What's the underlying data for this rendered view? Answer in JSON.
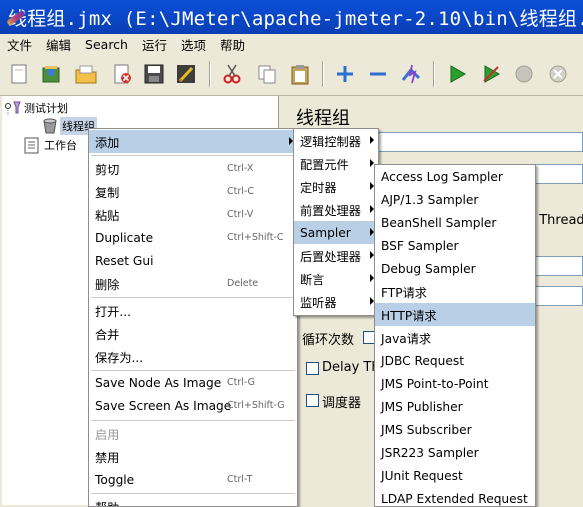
{
  "window": {
    "title": "线程组.jmx (E:\\JMeter\\apache-jmeter-2.10\\bin\\线程组."
  },
  "menubar": [
    "文件",
    "编辑",
    "Search",
    "运行",
    "选项",
    "帮助"
  ],
  "toolbar_icons": [
    "new-icon",
    "templates-icon",
    "open-icon",
    "close-icon",
    "save-icon",
    "save-as-image-icon",
    "cut-icon",
    "copy-icon",
    "paste-icon",
    "expand-icon",
    "collapse-icon",
    "toggle-icon",
    "start-icon",
    "start-no-pauses-icon",
    "stop-icon",
    "shutdown-icon"
  ],
  "tree": {
    "root": "测试计划",
    "thread_group": "线程组",
    "workbench": "工作台"
  },
  "panel": {
    "title": "线程组",
    "truncated_thread": "t Thread",
    "loop_label": "循环次数",
    "delay_label": "Delay Thr",
    "scheduler_label": "调度器"
  },
  "context_menu": {
    "items": [
      {
        "label": "添加",
        "submenu": true,
        "highlighted": true
      },
      {
        "label": "剪切",
        "shortcut": "Ctrl-X"
      },
      {
        "label": "复制",
        "shortcut": "Ctrl-C"
      },
      {
        "label": "粘贴",
        "shortcut": "Ctrl-V"
      },
      {
        "label": "Duplicate",
        "shortcut": "Ctrl+Shift-C"
      },
      {
        "label": "Reset Gui"
      },
      {
        "label": "删除",
        "shortcut": "Delete"
      },
      {
        "label": "打开..."
      },
      {
        "label": "合并"
      },
      {
        "label": "保存为..."
      },
      {
        "label": "Save Node As Image",
        "shortcut": "Ctrl-G"
      },
      {
        "label": "Save Screen As Image",
        "shortcut": "Ctrl+Shift-G"
      },
      {
        "label": "启用",
        "disabled": true
      },
      {
        "label": "禁用"
      },
      {
        "label": "Toggle",
        "shortcut": "Ctrl-T"
      },
      {
        "label": "帮助"
      }
    ]
  },
  "add_submenu": {
    "items": [
      {
        "label": "逻辑控制器"
      },
      {
        "label": "配置元件"
      },
      {
        "label": "定时器"
      },
      {
        "label": "前置处理器"
      },
      {
        "label": "Sampler",
        "highlighted": true
      },
      {
        "label": "后置处理器"
      },
      {
        "label": "断言"
      },
      {
        "label": "监听器"
      }
    ]
  },
  "sampler_submenu": {
    "items": [
      {
        "label": "Access Log Sampler"
      },
      {
        "label": "AJP/1.3 Sampler"
      },
      {
        "label": "BeanShell Sampler"
      },
      {
        "label": "BSF Sampler"
      },
      {
        "label": "Debug Sampler"
      },
      {
        "label": "FTP请求"
      },
      {
        "label": "HTTP请求",
        "highlighted": true
      },
      {
        "label": "Java请求"
      },
      {
        "label": "JDBC Request"
      },
      {
        "label": "JMS Point-to-Point"
      },
      {
        "label": "JMS Publisher"
      },
      {
        "label": "JMS Subscriber"
      },
      {
        "label": "JSR223 Sampler"
      },
      {
        "label": "JUnit Request"
      },
      {
        "label": "LDAP Extended Request"
      }
    ]
  },
  "colors": {
    "titlebar": "#0b4fd8",
    "highlight": "#b8cfe5",
    "chrome": "#ece9d8"
  }
}
